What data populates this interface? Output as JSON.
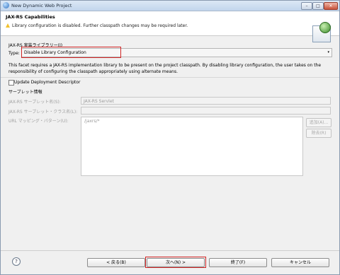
{
  "window": {
    "title": "New Dynamic Web Project",
    "controls": {
      "minimize": "–",
      "maximize": "□",
      "close": "✕"
    }
  },
  "header": {
    "title": "JAX-RS Capabilities",
    "message": "Library configuration is disabled. Further classpath changes may be required later.",
    "message_icon": "warning-icon"
  },
  "form": {
    "library_group_label": "JAX-RS 実装ライブラリー(I)",
    "type_label": "Type:",
    "type_value": "Disable Library Configuration",
    "type_arrow": "▾",
    "description": "This facet requires a JAX-RS implementation library to be present on the project classpath. By disabling library configuration, the user takes on the responsibility of configuring the classpath appropriately using alternate means.",
    "update_descriptor_label": "Update Deployment Descriptor",
    "servlet_group_label": "サーブレット情報",
    "servlet_name_label": "JAX-RS サーブレット名(S):",
    "servlet_name_value": "JAX-RS Servlet",
    "servlet_class_label": "JAX-RS サーブレット・クラス名(L):",
    "servlet_class_value": "",
    "url_mapping_label": "URL マッピング・パターン(U):",
    "url_mappings": [
      "/jaxrs/*"
    ],
    "add_button": "追加(A)...",
    "remove_button": "除去(R)"
  },
  "footer": {
    "help": "?",
    "back_button": "< 戻る(B)",
    "next_button": "次へ(N) >",
    "finish_button": "終了(F)",
    "cancel_button": "キャンセル"
  },
  "colors": {
    "highlight_box": "#d02424",
    "warning": "#f2c12e",
    "title_bar": "#c2d5ec"
  }
}
